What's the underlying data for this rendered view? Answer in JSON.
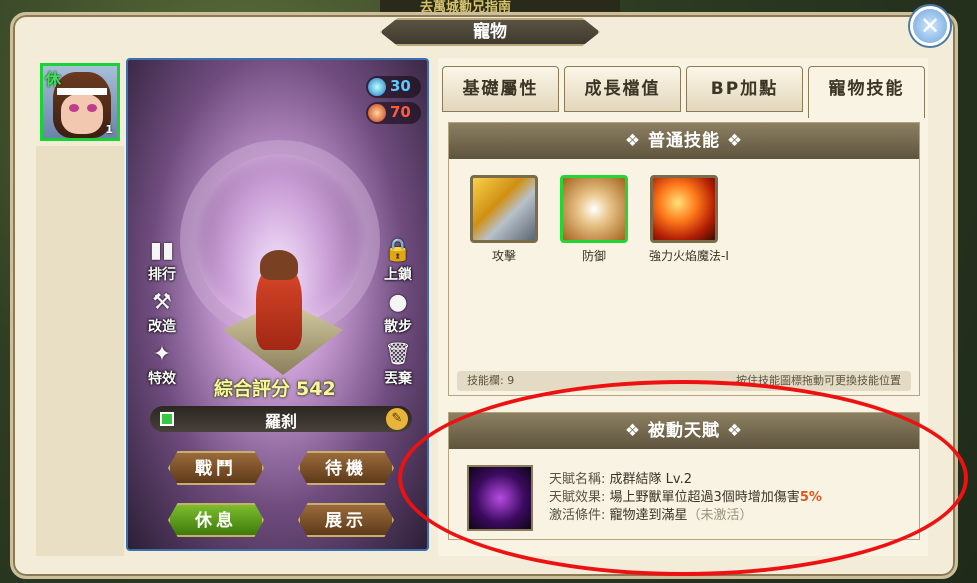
{
  "header": {
    "title": "寵物",
    "top_banner": "去萬城勸兄指南",
    "close_symbol": "✕"
  },
  "pet_slot": {
    "status_tag": "休",
    "level": "1"
  },
  "resources": [
    {
      "icon": "water-orb-icon",
      "value": "30",
      "color": "#5ec8ff"
    },
    {
      "icon": "fire-orb-icon",
      "value": "70",
      "color": "#ff5a3a"
    }
  ],
  "side_left": [
    {
      "icon": "ranking-icon",
      "glyph": "▮▮",
      "label": "排行"
    },
    {
      "icon": "wrench-icon",
      "glyph": "⚒",
      "label": "改造"
    },
    {
      "icon": "sparkle-icon",
      "glyph": "✦",
      "label": "特效"
    }
  ],
  "side_right": [
    {
      "icon": "lock-icon",
      "glyph": "🔒",
      "label": "上鎖"
    },
    {
      "icon": "paw-icon",
      "glyph": "●",
      "label": "散步"
    },
    {
      "icon": "trash-icon",
      "glyph": "🗑",
      "label": "丟棄"
    }
  ],
  "score": {
    "label": "綜合評分",
    "value": "542"
  },
  "pet_name": "羅刹",
  "actions": {
    "battle": "戰鬥",
    "standby": "待機",
    "rest": "休息",
    "display": "展示"
  },
  "tabs": [
    "基礎屬性",
    "成長檔值",
    "BP加點",
    "寵物技能"
  ],
  "active_tab": 3,
  "normal_skills": {
    "title": "❖ 普通技能 ❖",
    "skills": [
      {
        "name": "攻擊",
        "icon": "sword-icon"
      },
      {
        "name": "防御",
        "icon": "shield-icon"
      },
      {
        "name": "強力火焰魔法-Ⅰ",
        "icon": "fireball-icon"
      }
    ],
    "slot_label": "技能欄: 9",
    "hint": "按住技能圖標拖動可更換技能位置"
  },
  "passive": {
    "title": "❖ 被動天賦 ❖",
    "name_label": "天賦名稱:",
    "name_value": "成群結隊 Lv.2",
    "effect_label": "天賦效果:",
    "effect_value": "場上野獸單位超過3個時增加傷害",
    "effect_pct": "5%",
    "cond_label": "激活條件:",
    "cond_value": "寵物達到滿星",
    "cond_status": "（未激活）"
  },
  "colors": {
    "accent_green": "#23d633",
    "highlight_red": "#e11111",
    "tab_text": "#3c3424"
  }
}
